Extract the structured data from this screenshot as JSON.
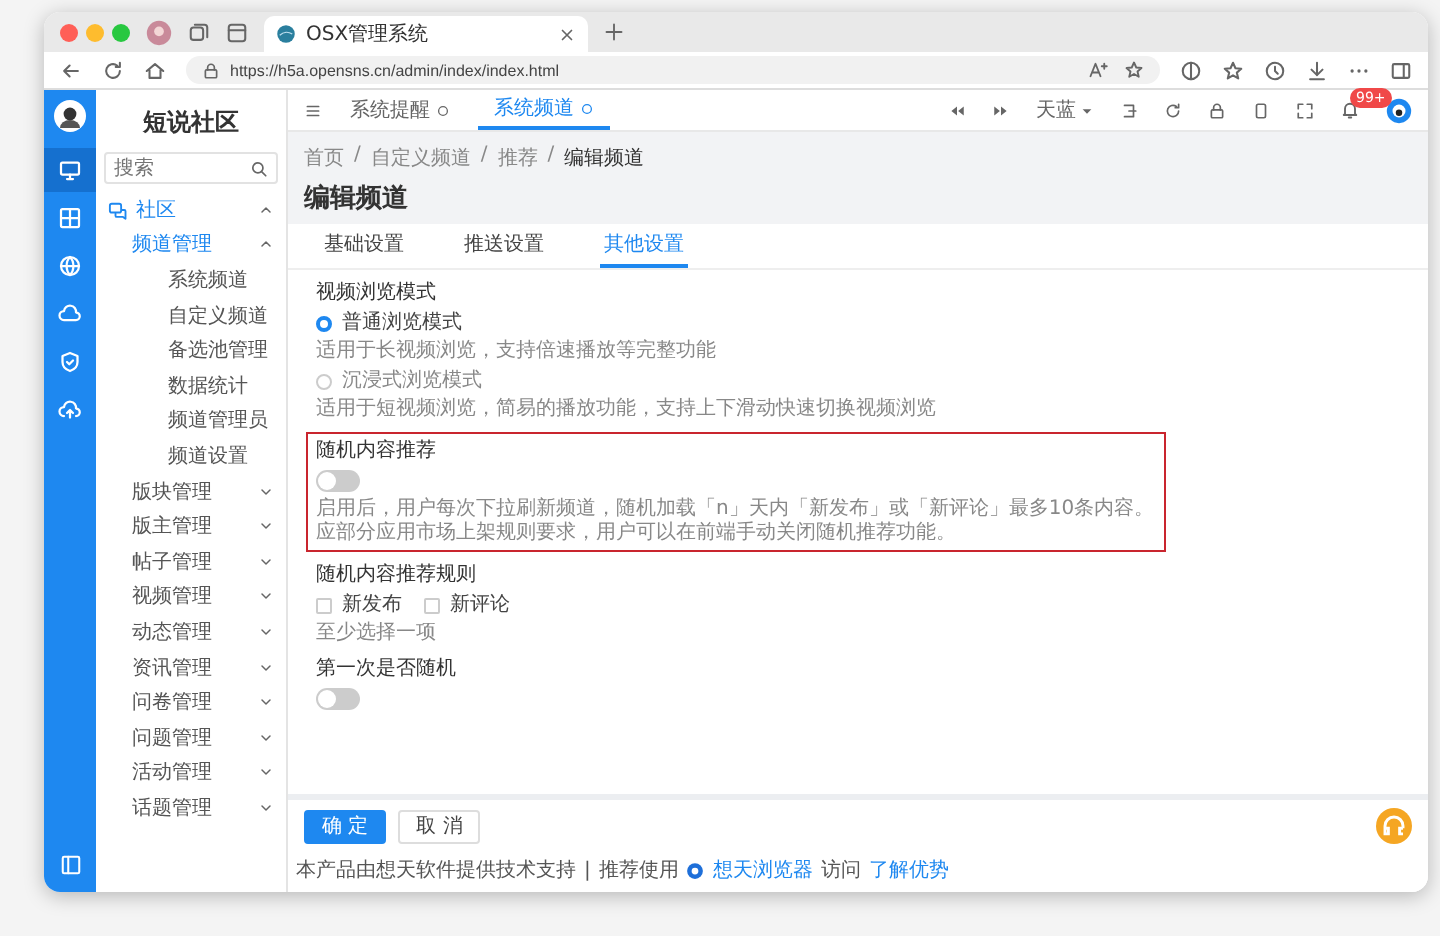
{
  "browser": {
    "tab_title": "OSX管理系统",
    "url": "https://h5a.opensns.cn/admin/index/index.html"
  },
  "rail": [
    {
      "kind": "monitor",
      "selected": true
    },
    {
      "kind": "grid",
      "selected": false
    },
    {
      "kind": "globe",
      "selected": false
    },
    {
      "kind": "cloud",
      "selected": false
    },
    {
      "kind": "shield",
      "selected": false
    },
    {
      "kind": "upload",
      "selected": false
    }
  ],
  "sidebar": {
    "logo": "短说社区",
    "search": {
      "placeholder": "搜索"
    },
    "items": [
      {
        "label": "社区",
        "expanded": true,
        "children": [
          {
            "label": "频道管理",
            "expanded": true,
            "children": [
              {
                "label": "系统频道"
              },
              {
                "label": "自定义频道"
              },
              {
                "label": "备选池管理"
              },
              {
                "label": "数据统计"
              },
              {
                "label": "频道管理员"
              },
              {
                "label": "频道设置"
              }
            ]
          },
          {
            "label": "版块管理",
            "expanded": false
          },
          {
            "label": "版主管理",
            "expanded": false
          },
          {
            "label": "帖子管理",
            "expanded": false
          },
          {
            "label": "视频管理",
            "expanded": false
          },
          {
            "label": "动态管理",
            "expanded": false
          },
          {
            "label": "资讯管理",
            "expanded": false
          },
          {
            "label": "问卷管理",
            "expanded": false
          },
          {
            "label": "问题管理",
            "expanded": false
          },
          {
            "label": "活动管理",
            "expanded": false
          },
          {
            "label": "话题管理",
            "expanded": false
          }
        ]
      }
    ]
  },
  "topbar": {
    "tabs": [
      {
        "label": "系统提醒",
        "selected": false
      },
      {
        "label": "系统频道",
        "selected": true
      }
    ],
    "theme": "天蓝",
    "badge": "99+"
  },
  "breadcrumb": {
    "separator": "/",
    "items": [
      "首页",
      "自定义频道",
      "推荐",
      "编辑频道"
    ]
  },
  "title": "编辑频道",
  "form_tabs": [
    {
      "label": "基础设置",
      "selected": false
    },
    {
      "label": "推送设置",
      "selected": false
    },
    {
      "label": "其他设置",
      "selected": true
    }
  ],
  "form": {
    "sections": [
      {
        "kind": "radio-group",
        "label": "视频浏览模式",
        "highlighted": false,
        "options": [
          {
            "label": "普通浏览模式",
            "selected": true,
            "help": "适用于长视频浏览，支持倍速播放等完整功能"
          },
          {
            "label": "沉浸式浏览模式",
            "selected": false,
            "help": "适用于短视频浏览，简易的播放功能，支持上下滑动快速切换视频浏览"
          }
        ]
      },
      {
        "kind": "switch",
        "label": "随机内容推荐",
        "highlighted": true,
        "on": false,
        "help": "启用后，用户每次下拉刷新频道，随机加载「n」天内「新发布」或「新评论」最多10条内容。应部分应用市场上架规则要求，用户可以在前端手动关闭随机推荐功能。"
      },
      {
        "kind": "checkbox-group",
        "label": "随机内容推荐规则",
        "highlighted": false,
        "options": [
          {
            "label": "新发布",
            "checked": false
          },
          {
            "label": "新评论",
            "checked": false
          }
        ],
        "help": "至少选择一项"
      },
      {
        "kind": "switch",
        "label": "第一次是否随机",
        "highlighted": false,
        "on": false
      }
    ]
  },
  "actions": [
    {
      "label": "确 定",
      "kind": "primary"
    },
    {
      "label": "取 消",
      "kind": "default"
    }
  ],
  "footer": [
    {
      "kind": "text",
      "text": "本产品由想天软件提供技术支持"
    },
    {
      "kind": "separator",
      "text": "|"
    },
    {
      "kind": "text",
      "text": "推荐使用"
    },
    {
      "kind": "browser-link",
      "text": "想天浏览器"
    },
    {
      "kind": "text",
      "text": "访问"
    },
    {
      "kind": "link",
      "text": "了解优势"
    }
  ]
}
